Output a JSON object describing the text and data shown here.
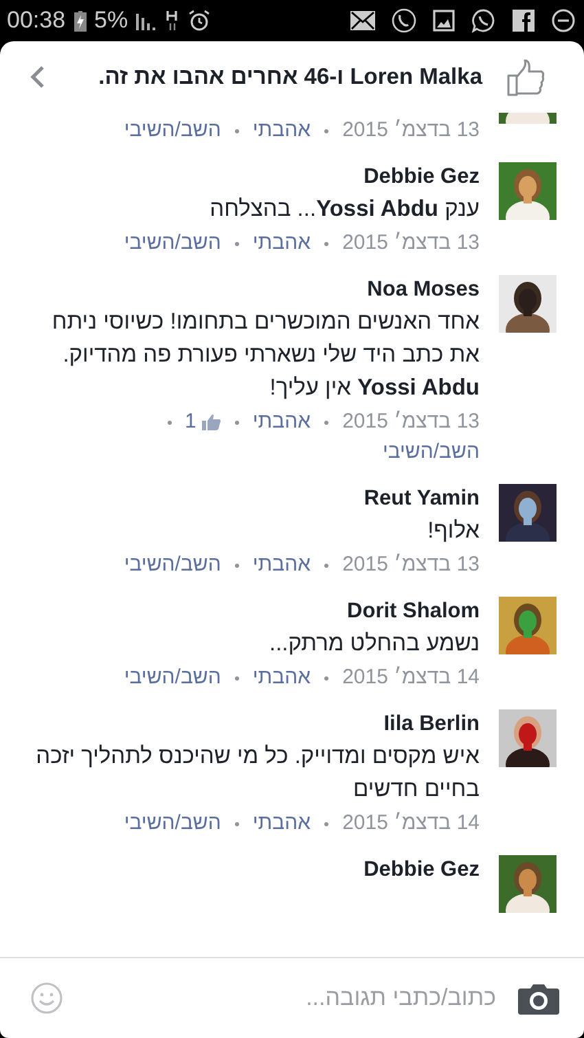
{
  "status_bar": {
    "time": "00:38",
    "battery": "5%"
  },
  "header": {
    "title": "Loren Malka ו-46 אחרים אהבו את זה."
  },
  "comments": [
    {
      "kind": "partial",
      "date": "13 בדצמ׳ 2015",
      "like": "אהבתי",
      "reply": "השב/השיבי"
    },
    {
      "kind": "full",
      "name": "Debbie Gez",
      "text": "ענק **Yossi Abdu**... בהצלחה",
      "date": "13 בדצמ׳ 2015",
      "like": "אהבתי",
      "reply": "השב/השיבי"
    },
    {
      "kind": "full",
      "name": "Noa Moses",
      "text": "אחד האנשים המוכשרים בתחומו! כשיוסי ניתח את כתב היד שלי נשארתי פעורת פה מהדיוק. **Yossi Abdu** אין עליך!",
      "date": "13 בדצמ׳ 2015",
      "like": "אהבתי",
      "likes": "1",
      "reply": "השב/השיבי"
    },
    {
      "kind": "full",
      "name": "Reut Yamin",
      "text": "אלוף!",
      "date": "13 בדצמ׳ 2015",
      "like": "אהבתי",
      "reply": "השב/השיבי"
    },
    {
      "kind": "full",
      "name": "Dorit Shalom",
      "text": "נשמע בהחלט מרתק...",
      "date": "14 בדצמ׳ 2015",
      "like": "אהבתי",
      "reply": "השב/השיבי"
    },
    {
      "kind": "full",
      "name": "Iila Berlin",
      "text": "איש מקסים ומדוייק. כל מי שהיכנס לתהליך יזכה בחיים חדשים",
      "date": "14 בדצמ׳ 2015",
      "like": "אהבתי",
      "reply": "השב/השיבי"
    },
    {
      "kind": "cut",
      "name": "Debbie Gez"
    }
  ],
  "composer": {
    "placeholder": "כתוב/כתבי תגובה..."
  }
}
